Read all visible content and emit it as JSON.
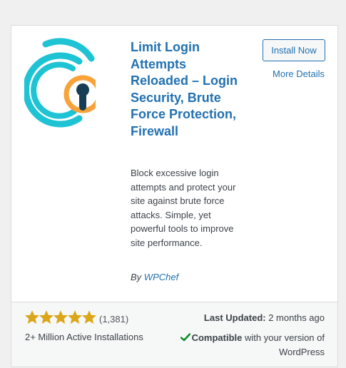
{
  "plugin": {
    "title": "Limit Login Attempts Reloaded – Login Security, Brute Force Protection, Firewall",
    "description": "Block excessive login attempts and protect your site against brute force attacks. Simple, yet powerful tools to improve site performance.",
    "author_prefix": "By",
    "author_name": "WPChef",
    "logo_icon": "lock-keyhole-logo-icon"
  },
  "actions": {
    "install_label": "Install Now",
    "more_details_label": "More Details"
  },
  "footer": {
    "rating": 5,
    "rating_max": 5,
    "rating_count": "(1,381)",
    "installs": "2+ Million Active Installations",
    "last_updated_label": "Last Updated:",
    "last_updated_value": "2 months ago",
    "compatible_label": "Compatible",
    "compatible_suffix": "with your version of WordPress"
  },
  "colors": {
    "accent": "#2271b1",
    "star": "#dba617",
    "check": "#008a20",
    "logo_teal": "#1ec3d4",
    "logo_orange": "#f8a33a",
    "logo_navy": "#183e55"
  }
}
